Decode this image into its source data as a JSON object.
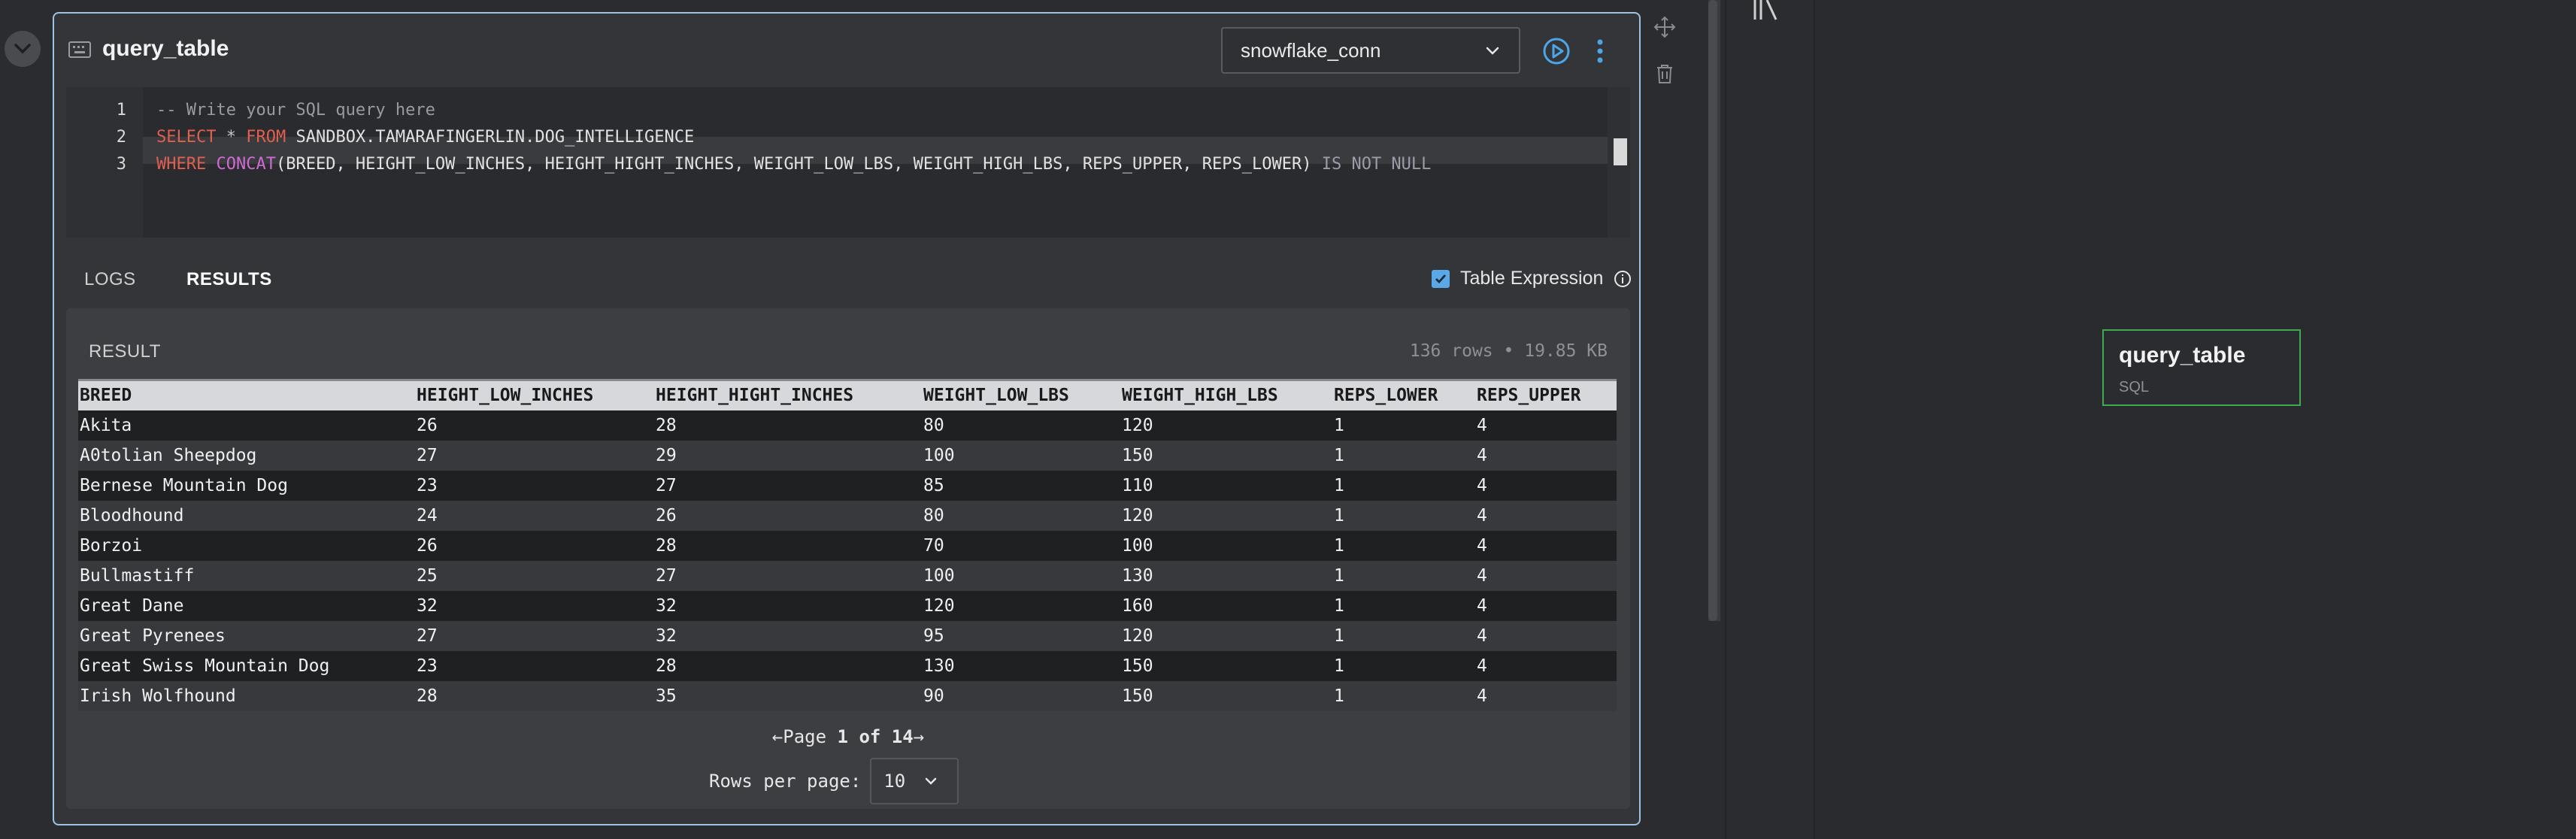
{
  "cell": {
    "title": "query_table",
    "connection": "snowflake_conn"
  },
  "editor": {
    "line_numbers": [
      "1",
      "2",
      "3"
    ],
    "line1": {
      "comment": "-- Write your SQL query here"
    },
    "line2": {
      "select": "SELECT",
      "star": "*",
      "from": "FROM",
      "table": "SANDBOX.TAMARAFINGERLIN.DOG_INTELLIGENCE"
    },
    "line3": {
      "where": "WHERE",
      "concat": "CONCAT",
      "args": "(BREED, HEIGHT_LOW_INCHES, HEIGHT_HIGHT_INCHES, WEIGHT_LOW_LBS, WEIGHT_HIGH_LBS, REPS_UPPER, REPS_LOWER)",
      "tail": "IS NOT NULL"
    }
  },
  "tabs": {
    "logs": "LOGS",
    "results": "RESULTS"
  },
  "table_expression": {
    "label": "Table Expression",
    "checked": true
  },
  "result": {
    "label": "RESULT",
    "rows": "136 rows",
    "sep": "•",
    "size": "19.85 KB",
    "columns": [
      "BREED",
      "HEIGHT_LOW_INCHES",
      "HEIGHT_HIGHT_INCHES",
      "WEIGHT_LOW_LBS",
      "WEIGHT_HIGH_LBS",
      "REPS_LOWER",
      "REPS_UPPER"
    ],
    "data": [
      [
        "Akita",
        "26",
        "28",
        "80",
        "120",
        "1",
        "4"
      ],
      [
        "A0tolian Sheepdog",
        "27",
        "29",
        "100",
        "150",
        "1",
        "4"
      ],
      [
        "Bernese Mountain Dog",
        "23",
        "27",
        "85",
        "110",
        "1",
        "4"
      ],
      [
        "Bloodhound",
        "24",
        "26",
        "80",
        "120",
        "1",
        "4"
      ],
      [
        "Borzoi",
        "26",
        "28",
        "70",
        "100",
        "1",
        "4"
      ],
      [
        "Bullmastiff",
        "25",
        "27",
        "100",
        "130",
        "1",
        "4"
      ],
      [
        "Great Dane",
        "32",
        "32",
        "120",
        "160",
        "1",
        "4"
      ],
      [
        "Great Pyrenees",
        "27",
        "32",
        "95",
        "120",
        "1",
        "4"
      ],
      [
        "Great Swiss Mountain Dog",
        "23",
        "28",
        "130",
        "150",
        "1",
        "4"
      ],
      [
        "Irish Wolfhound",
        "28",
        "35",
        "90",
        "150",
        "1",
        "4"
      ]
    ]
  },
  "pager": {
    "prev": "←",
    "page_word": "Page",
    "current": "1",
    "of_word": "of",
    "total": "14",
    "next": "→"
  },
  "rows_per_page": {
    "label": "Rows per page:",
    "value": "10"
  },
  "node": {
    "title": "query_table",
    "subtitle": "SQL"
  }
}
